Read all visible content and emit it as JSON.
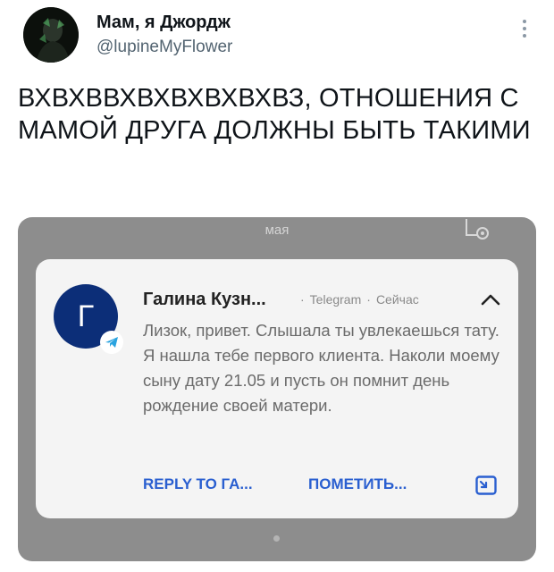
{
  "tweet": {
    "display_name": "Мам, я Джордж",
    "handle": "@lupineMyFlower",
    "text": "ВХВХВВХВХВХВХВХВЗ, ОТНОШЕНИЯ С МАМОЙ ДРУГА ДОЛЖНЫ БЫТЬ ТАКИМИ"
  },
  "screenshot": {
    "top_label": "мая",
    "top_right_icon": "lock-settings-icon",
    "notification": {
      "avatar_letter": "Г",
      "sender": "Галина Кузн...",
      "app": "Telegram",
      "time": "Сейчас",
      "message": "Лизок, привет. Слышала ты увлекаешься тату. Я нашла тебе первого клиента. Наколи моему сыну дату 21.05 и пусть он помнит день рождение своей матери.",
      "actions": {
        "reply": "REPLY TO ГА...",
        "mark": "ПОМЕТИТЬ..."
      }
    }
  },
  "colors": {
    "action_blue": "#2a5fd0",
    "avatar_navy": "#0c2e78",
    "telegram_blue": "#2aa3df"
  }
}
